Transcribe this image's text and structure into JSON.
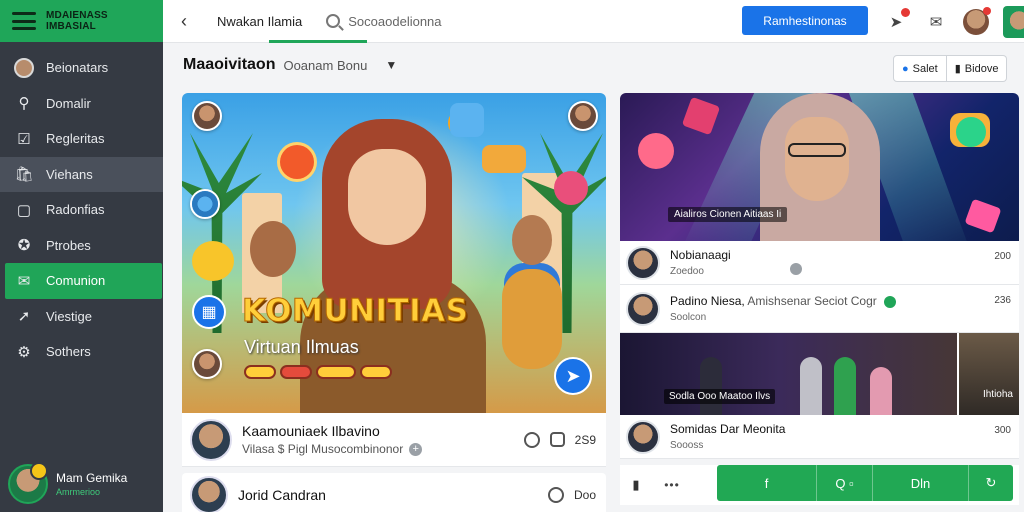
{
  "brand": {
    "line1": "MDAIENASS",
    "line2": "IMBASIAL"
  },
  "sidebar": {
    "items": [
      {
        "label": "Beionatars",
        "icon": "avatar-icon"
      },
      {
        "label": "Domalir",
        "icon": "search-icon"
      },
      {
        "label": "Regleritas",
        "icon": "checkbox-icon"
      },
      {
        "label": "Viehans",
        "icon": "bag-icon"
      },
      {
        "label": "Radonfias",
        "icon": "calendar-icon"
      },
      {
        "label": "Ptrobes",
        "icon": "puzzle-icon"
      },
      {
        "label": "Comunion",
        "icon": "chat-icon"
      },
      {
        "label": "Viestige",
        "icon": "compass-icon"
      },
      {
        "label": "Sothers",
        "icon": "settings-icon"
      }
    ],
    "user": {
      "name": "Mam Gemika",
      "role": "Amrmerioo"
    }
  },
  "topbar": {
    "back_icon": "back-arrow-icon",
    "tab_title": "Nwakan Ilamia",
    "search_placeholder": "Socoaodelionna",
    "primary_button": "Ramhestinonas"
  },
  "header": {
    "title": "Maaoivitaon",
    "subtitle": "Ooanam Bonu",
    "pill_left": "Salet",
    "pill_right": "Bidove"
  },
  "left": {
    "hero": {
      "title": "KOMUNITIAS",
      "subtitle": "Virtuan Ilmuas"
    },
    "card1": {
      "name": "Kaamouniaek Ilbavino",
      "meta": "Vilasa $ Pigl Musocombinonor",
      "count": "2S9"
    },
    "card2": {
      "name": "Jorid Candran",
      "count": "Doo"
    }
  },
  "right": {
    "hero_caption": "Aialiros Cionen Aitiaas Ii",
    "feed": [
      {
        "name": "Nobianaagi",
        "sub": "Zoedoo",
        "count": "200"
      },
      {
        "name": "Padino Niesa,",
        "name_rest": "Amishsenar Seciot Cogr",
        "sub": "Soolcon",
        "count": "236"
      }
    ],
    "video_caption": "Sodla Ooo Maatoo Ilvs",
    "video_side_caption": "Ihtioha",
    "feed3": {
      "name": "Somidas Dar Meonita",
      "sub": "Soooss",
      "count": "300"
    },
    "actionbar": {
      "dots": "•••",
      "btn1": "f",
      "btn2": "Q",
      "btn3": "Dln"
    }
  },
  "colors": {
    "brand_green": "#1fa659",
    "sidebar_bg": "#353a43",
    "primary_blue": "#1a73e8"
  }
}
